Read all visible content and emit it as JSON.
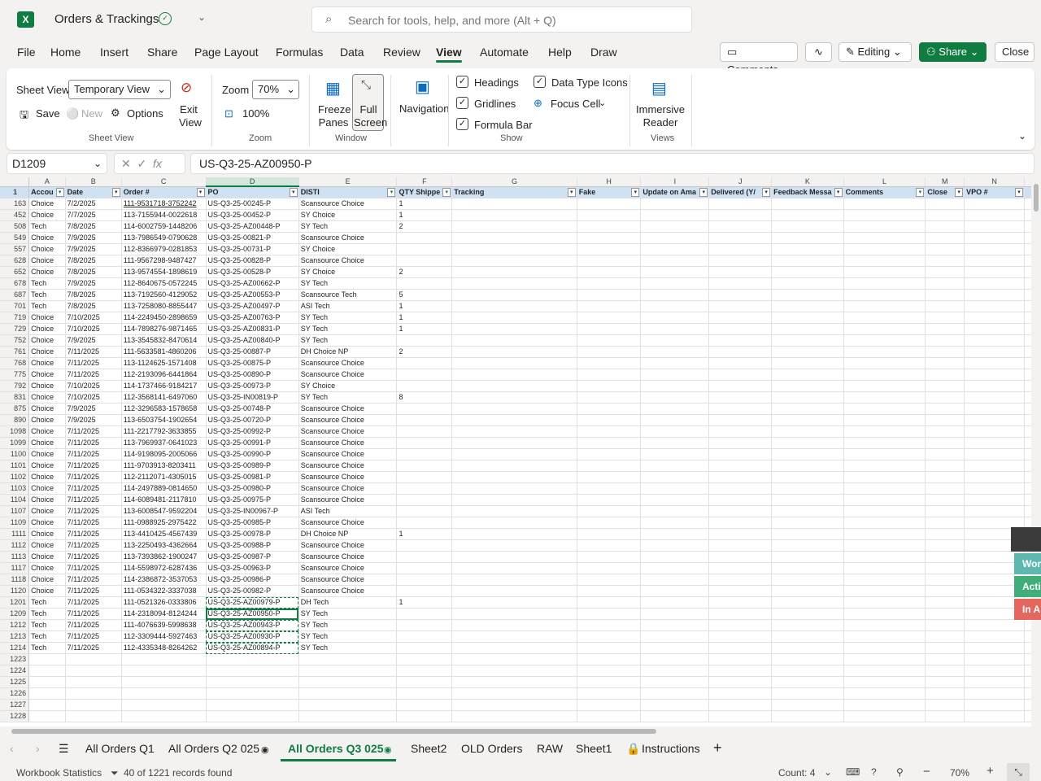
{
  "app": {
    "title": "Orders & Trackings",
    "logo": "X"
  },
  "search": {
    "placeholder": "Search for tools, help, and more (Alt + Q)"
  },
  "menu": [
    "File",
    "Home",
    "Insert",
    "Share",
    "Page Layout",
    "Formulas",
    "Data",
    "Review",
    "View",
    "Automate",
    "Help",
    "Draw"
  ],
  "menu_active": "View",
  "right_buttons": {
    "comments": "Comments",
    "editing": "Editing",
    "share": "Share",
    "close": "Close"
  },
  "ribbon": {
    "sheet_view_label": "Sheet View",
    "sheet_view_value": "Temporary View",
    "save": "Save",
    "new": "New",
    "options": "Options",
    "exit_view": "Exit View",
    "group_sheet_view": "Sheet View",
    "zoom_label": "Zoom",
    "zoom_value": "70%",
    "zoom_100": "100%",
    "group_zoom": "Zoom",
    "freeze_panes": "Freeze Panes",
    "full_screen": "Full Screen",
    "group_window": "Window",
    "navigation": "Navigation",
    "headings": "Headings",
    "gridlines": "Gridlines",
    "formula_bar": "Formula Bar",
    "data_type_icons": "Data Type Icons",
    "focus_cell": "Focus Cell",
    "group_show": "Show",
    "immersive_reader": "Immersive Reader",
    "group_views": "Views"
  },
  "formula_bar": {
    "name_box": "D1209",
    "fx": "fx",
    "formula": "US-Q3-25-AZ00950-P"
  },
  "columns": [
    "A",
    "B",
    "C",
    "D",
    "E",
    "F",
    "G",
    "H",
    "I",
    "J",
    "K",
    "L",
    "M",
    "N"
  ],
  "headers": [
    "Accou",
    "Date",
    "Order #",
    "PO",
    "DISTI",
    "QTY Shippe",
    "Tracking",
    "Fake",
    "Update on Ama",
    "Delivered (Y/",
    "Feedback Messa",
    "Comments",
    "Close",
    "VPO #"
  ],
  "rows": [
    [
      "163",
      "Choice",
      "7/2/2025",
      "111-9531718-3752242",
      "US-Q3-25-00245-P",
      "Scansource Choice",
      "1"
    ],
    [
      "452",
      "Choice",
      "7/7/2025",
      "113-7155944-0022618",
      "US-Q3-25-00452-P",
      "SY Choice",
      "1"
    ],
    [
      "508",
      "Tech",
      "7/8/2025",
      "114-6002759-1448206",
      "US-Q3-25-AZ00448-P",
      "SY Tech",
      "2"
    ],
    [
      "549",
      "Choice",
      "7/9/2025",
      "113-7986549-0790628",
      "US-Q3-25-00821-P",
      "Scansource Choice",
      ""
    ],
    [
      "557",
      "Choice",
      "7/9/2025",
      "112-8366979-0281853",
      "US-Q3-25-00731-P",
      "SY Choice",
      ""
    ],
    [
      "628",
      "Choice",
      "7/8/2025",
      "111-9567298-9487427",
      "US-Q3-25-00828-P",
      "Scansource Choice",
      ""
    ],
    [
      "652",
      "Choice",
      "7/8/2025",
      "113-9574554-1898619",
      "US-Q3-25-00528-P",
      "SY Choice",
      "2"
    ],
    [
      "678",
      "Tech",
      "7/9/2025",
      "112-8640675-0572245",
      "US-Q3-25-AZ00662-P",
      "SY Tech",
      ""
    ],
    [
      "687",
      "Tech",
      "7/8/2025",
      "113-7192560-4129052",
      "US-Q3-25-AZ00553-P",
      "Scansource Tech",
      "5"
    ],
    [
      "701",
      "Tech",
      "7/8/2025",
      "113-7258080-8855447",
      "US-Q3-25-AZ00497-P",
      "ASI Tech",
      "1"
    ],
    [
      "719",
      "Choice",
      "7/10/2025",
      "114-2249450-2898659",
      "US-Q3-25-AZ00763-P",
      "SY Tech",
      "1"
    ],
    [
      "729",
      "Choice",
      "7/10/2025",
      "114-7898276-9871465",
      "US-Q3-25-AZ00831-P",
      "SY Tech",
      "1"
    ],
    [
      "752",
      "Choice",
      "7/9/2025",
      "113-3545832-8470614",
      "US-Q3-25-AZ00840-P",
      "SY Tech",
      ""
    ],
    [
      "761",
      "Choice",
      "7/11/2025",
      "111-5633581-4860206",
      "US-Q3-25-00887-P",
      "DH Choice NP",
      "2"
    ],
    [
      "768",
      "Choice",
      "7/11/2025",
      "113-1124625-1571408",
      "US-Q3-25-00875-P",
      "Scansource Choice",
      ""
    ],
    [
      "775",
      "Choice",
      "7/11/2025",
      "112-2193096-6441864",
      "US-Q3-25-00890-P",
      "Scansource Choice",
      ""
    ],
    [
      "792",
      "Choice",
      "7/10/2025",
      "114-1737466-9184217",
      "US-Q3-25-00973-P",
      "SY Choice",
      ""
    ],
    [
      "831",
      "Choice",
      "7/10/2025",
      "112-3568141-6497060",
      "US-Q3-25-IN00819-P",
      "SY Tech",
      "8"
    ],
    [
      "875",
      "Choice",
      "7/9/2025",
      "112-3296583-1578658",
      "US-Q3-25-00748-P",
      "Scansource Choice",
      ""
    ],
    [
      "890",
      "Choice",
      "7/9/2025",
      "113-6503754-1902654",
      "US-Q3-25-00720-P",
      "Scansource Choice",
      ""
    ],
    [
      "1098",
      "Choice",
      "7/11/2025",
      "111-2217792-3633855",
      "US-Q3-25-00992-P",
      "Scansource Choice",
      ""
    ],
    [
      "1099",
      "Choice",
      "7/11/2025",
      "113-7969937-0641023",
      "US-Q3-25-00991-P",
      "Scansource Choice",
      ""
    ],
    [
      "1100",
      "Choice",
      "7/11/2025",
      "114-9198095-2005066",
      "US-Q3-25-00990-P",
      "Scansource Choice",
      ""
    ],
    [
      "1101",
      "Choice",
      "7/11/2025",
      "111-9703913-8203411",
      "US-Q3-25-00989-P",
      "Scansource Choice",
      ""
    ],
    [
      "1102",
      "Choice",
      "7/11/2025",
      "112-2112071-4305015",
      "US-Q3-25-00981-P",
      "Scansource Choice",
      ""
    ],
    [
      "1103",
      "Choice",
      "7/11/2025",
      "114-2497889-0814650",
      "US-Q3-25-00980-P",
      "Scansource Choice",
      ""
    ],
    [
      "1104",
      "Choice",
      "7/11/2025",
      "114-6089481-2117810",
      "US-Q3-25-00975-P",
      "Scansource Choice",
      ""
    ],
    [
      "1107",
      "Choice",
      "7/11/2025",
      "113-6008547-9592204",
      "US-Q3-25-IN00967-P",
      "ASI Tech",
      ""
    ],
    [
      "1109",
      "Choice",
      "7/11/2025",
      "111-0988925-2975422",
      "US-Q3-25-00985-P",
      "Scansource Choice",
      ""
    ],
    [
      "1111",
      "Choice",
      "7/11/2025",
      "113-4410425-4567439",
      "US-Q3-25-00978-P",
      "DH Choice NP",
      "1"
    ],
    [
      "1112",
      "Choice",
      "7/11/2025",
      "113-2250493-4362664",
      "US-Q3-25-00988-P",
      "Scansource Choice",
      ""
    ],
    [
      "1113",
      "Choice",
      "7/11/2025",
      "113-7393862-1900247",
      "US-Q3-25-00987-P",
      "Scansource Choice",
      ""
    ],
    [
      "1117",
      "Choice",
      "7/11/2025",
      "114-5598972-6287436",
      "US-Q3-25-00963-P",
      "Scansource Choice",
      ""
    ],
    [
      "1118",
      "Choice",
      "7/11/2025",
      "114-2386872-3537053",
      "US-Q3-25-00986-P",
      "Scansource Choice",
      ""
    ],
    [
      "1120",
      "Choice",
      "7/11/2025",
      "111-0534322-3337038",
      "US-Q3-25-00982-P",
      "Scansource Choice",
      ""
    ],
    [
      "1201",
      "Tech",
      "7/11/2025",
      "111-0521326-0333806",
      "US-Q3-25-AZ00979-P",
      "DH Tech",
      "1"
    ],
    [
      "1209",
      "Tech",
      "7/11/2025",
      "114-2318094-8124244",
      "US-Q3-25-AZ00950-P",
      "SY Tech",
      ""
    ],
    [
      "1212",
      "Tech",
      "7/11/2025",
      "111-4076639-5998638",
      "US-Q3-25-AZ00943-P",
      "SY Tech",
      ""
    ],
    [
      "1213",
      "Tech",
      "7/11/2025",
      "112-3309444-5927463",
      "US-Q3-25-AZ00930-P",
      "SY Tech",
      ""
    ],
    [
      "1214",
      "Tech",
      "7/11/2025",
      "112-4335348-8264262",
      "US-Q3-25-AZ00894-P",
      "SY Tech",
      ""
    ]
  ],
  "empty_rows": [
    "1223",
    "1224",
    "1225",
    "1226",
    "1227",
    "1228"
  ],
  "sheets": [
    "All Orders Q1",
    "All Orders Q2 025",
    "All Orders Q3 025",
    "Sheet2",
    "OLD Orders",
    "RAW",
    "Sheet1",
    "Instructions"
  ],
  "active_sheet": "All Orders Q3 025",
  "status": {
    "stats": "Workbook Statistics",
    "filter": "40 of 1221 records found",
    "count": "Count: 4",
    "zoom": "70%"
  },
  "side_panel": {
    "btn1": "Wor",
    "btn2": "Acti",
    "btn3": "In A",
    "colors": {
      "btn1": "#5fb8b0",
      "btn2": "#3fae7a",
      "btn3": "#e4675f"
    }
  },
  "colors": {
    "accent": "#107c41",
    "header_fill": "#cfe2f3"
  }
}
